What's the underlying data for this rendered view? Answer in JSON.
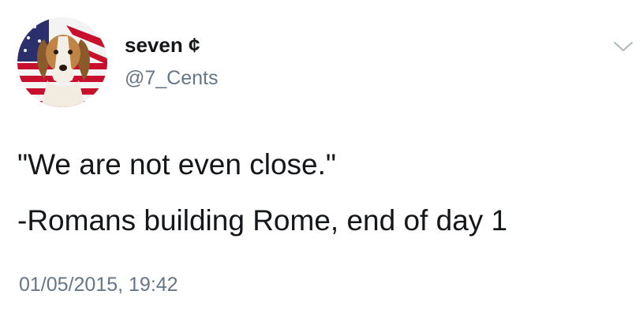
{
  "tweet": {
    "author": {
      "display_name": "seven ¢",
      "handle": "@7_Cents",
      "avatar_icon": "dog-with-flag-avatar"
    },
    "menu_icon": "chevron-down-icon",
    "text_lines": [
      "\"We are not even close.\"",
      "-Romans building Rome, end of day 1"
    ],
    "timestamp": "01/05/2015, 19:42"
  },
  "colors": {
    "primary_text": "#14171a",
    "secondary_text": "#657786",
    "caret": "#aab8c2",
    "background": "#ffffff"
  }
}
